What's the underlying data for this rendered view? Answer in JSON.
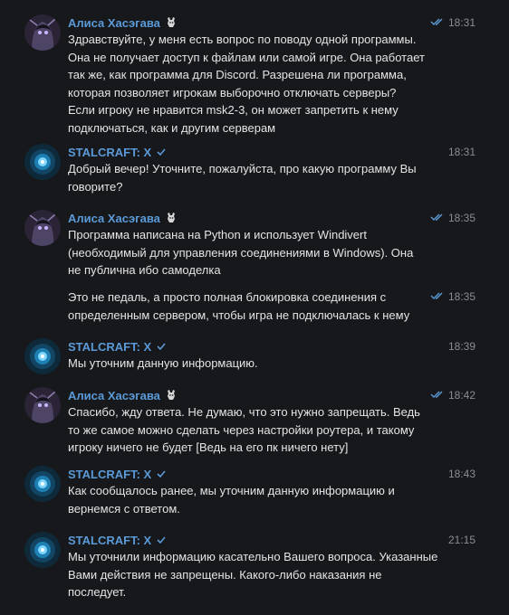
{
  "messages": [
    {
      "sender": "Алиса Хасэгава",
      "author": "alisa",
      "time": "18:31",
      "read": true,
      "text": "Здравствуйте, у меня есть вопрос по поводу одной программы.\nОна не получает доступ к файлам или самой игре. Она работает\nтак же, как программа для Discord. Разрешена ли программа,\nкоторая позволяет игрокам выборочно отключать серверы?\nЕсли игроку не нравится msk2-3, он может запретить к нему\nподключаться, как и другим серверам"
    },
    {
      "sender": "STALCRAFT: X",
      "author": "stalcraft",
      "time": "18:31",
      "read": false,
      "text": "Добрый вечер! Уточните, пожалуйста, про какую программу Вы\nговорите?"
    },
    {
      "sender": "Алиса Хасэгава",
      "author": "alisa",
      "time": "18:35",
      "read": true,
      "text": "Программа написана на Python и использует Windivert\n(необходимый для управления соединениями в Windows). Она\nне публична ибо самоделка"
    },
    {
      "sender": "",
      "author": "alisa",
      "time": "18:35",
      "read": true,
      "text": "Это не педаль, а просто полная блокировка соединения с\nопределенным сервером, чтобы игра не подключалась к нему"
    },
    {
      "sender": "STALCRAFT: X",
      "author": "stalcraft",
      "time": "18:39",
      "read": false,
      "text": "Мы уточним данную информацию."
    },
    {
      "sender": "Алиса Хасэгава",
      "author": "alisa",
      "time": "18:42",
      "read": true,
      "text": "Спасибо, жду ответа. Не думаю, что это нужно запрещать. Ведь\nто же самое можно сделать через настройки роутера, и такому\nигроку ничего не будет [Ведь на его пк ничего нету]"
    },
    {
      "sender": "STALCRAFT: X",
      "author": "stalcraft",
      "time": "18:43",
      "read": false,
      "text": "Как сообщалось ранее, мы уточним данную информацию и\nвернемся с ответом."
    },
    {
      "sender": "STALCRAFT: X",
      "author": "stalcraft",
      "time": "21:15",
      "read": false,
      "text": "Мы уточнили информацию касательно Вашего вопроса. Указанные\nВами действия не запрещены. Какого-либо наказания не\nпоследует."
    }
  ]
}
